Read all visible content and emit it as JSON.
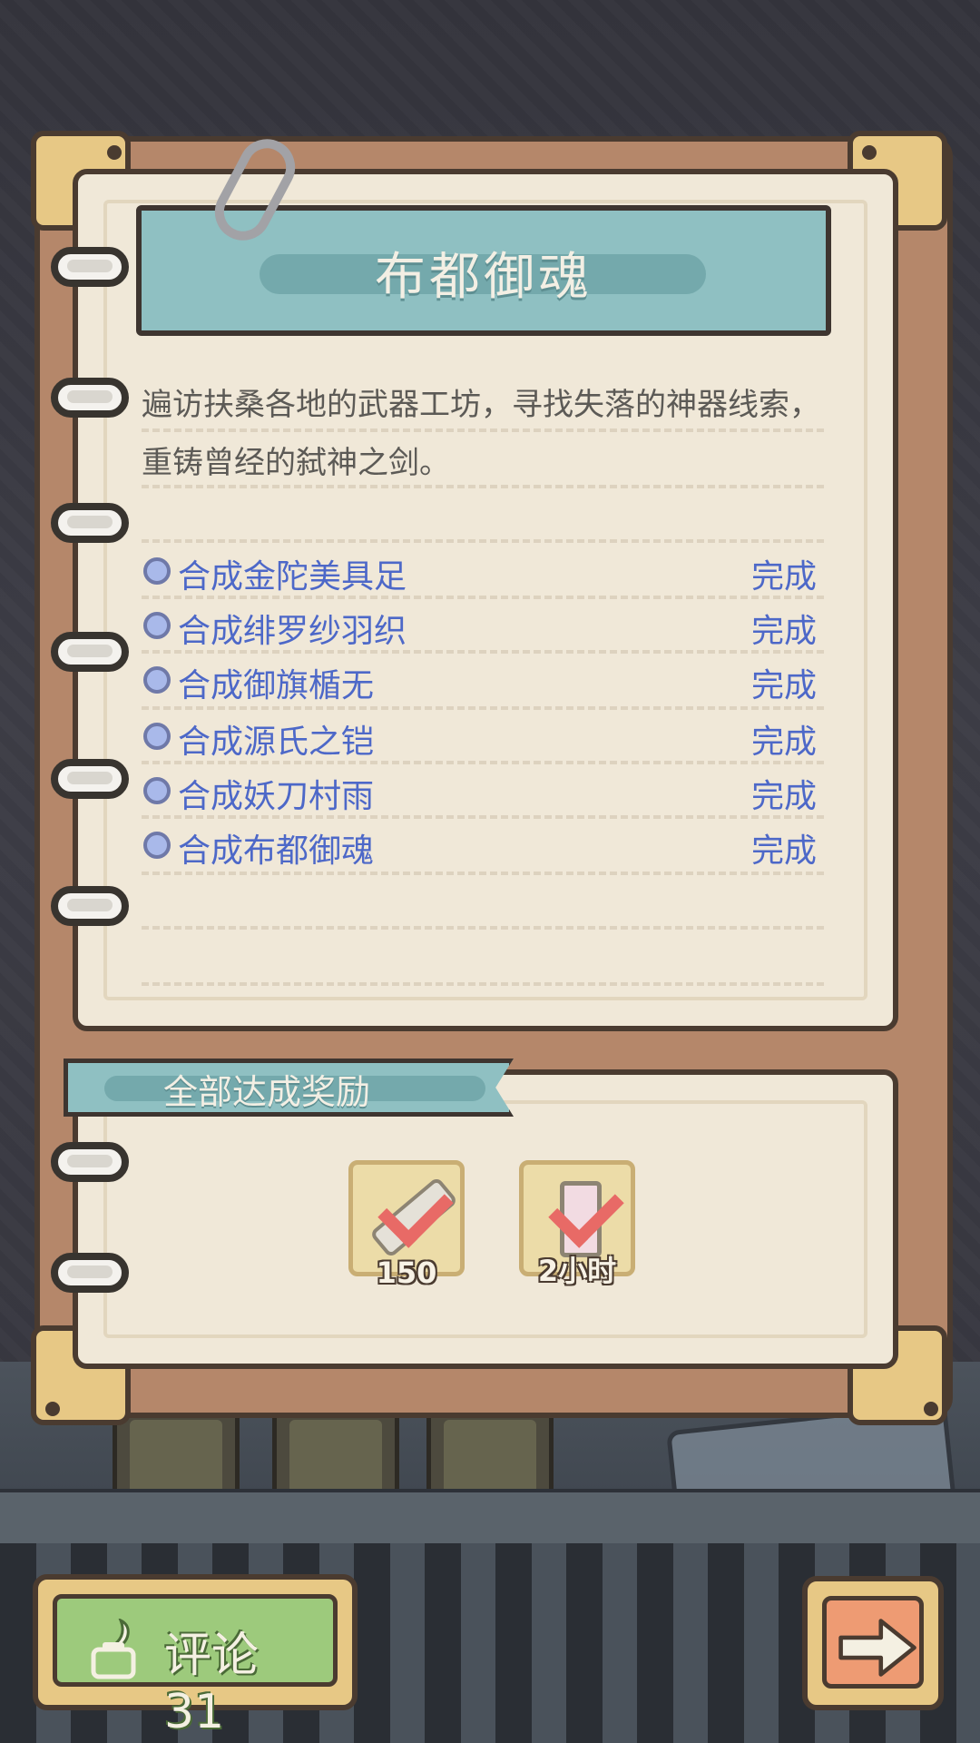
{
  "quest": {
    "title": "布都御魂",
    "description": "遍访扶桑各地的武器工坊，寻找失落的神器线索，重铸曾经的弑神之剑。",
    "tasks": [
      {
        "name": "合成金陀美具足",
        "status": "完成"
      },
      {
        "name": "合成绯罗纱羽织",
        "status": "完成"
      },
      {
        "name": "合成御旗楯无",
        "status": "完成"
      },
      {
        "name": "合成源氏之铠",
        "status": "完成"
      },
      {
        "name": "合成妖刀村雨",
        "status": "完成"
      },
      {
        "name": "合成布都御魂",
        "status": "完成"
      }
    ]
  },
  "reward": {
    "label": "全部达成奖励",
    "items": [
      {
        "icon": "tube-icon",
        "quantity": "150",
        "claimed": true
      },
      {
        "icon": "hourglass-icon",
        "quantity": "2小时",
        "claimed": true
      }
    ]
  },
  "footer": {
    "comment_label": "评论 31",
    "next_icon": "arrow-right-icon"
  },
  "colors": {
    "task_text": "#4d68c8",
    "banner": "#8fc0c2",
    "check": "#e86a66"
  }
}
